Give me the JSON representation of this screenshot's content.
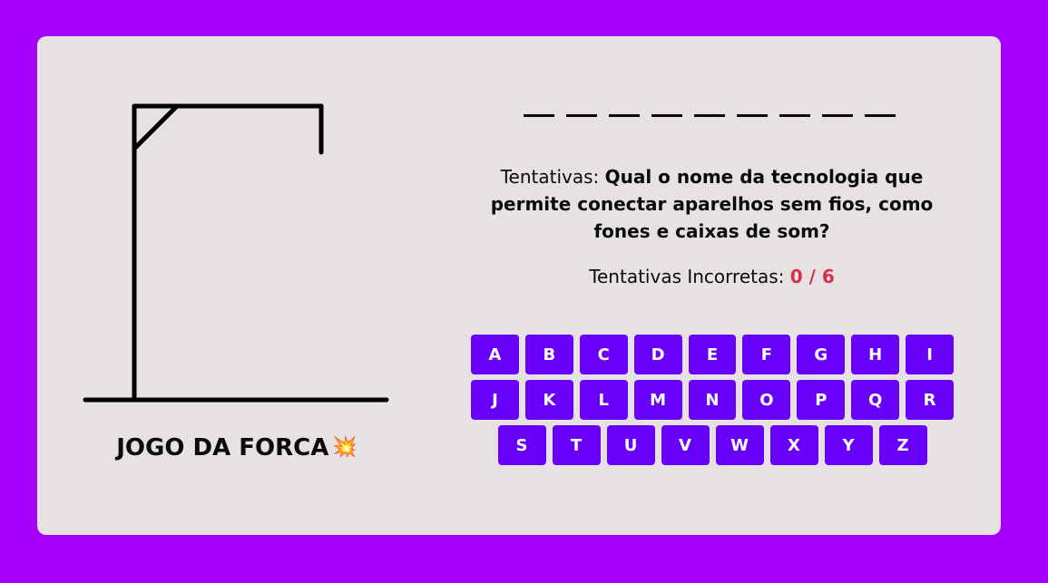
{
  "game": {
    "title": "JOGO DA FORCA",
    "title_emoji": "💥",
    "word_length": 9,
    "hint_label": "Tentativas:",
    "hint_text": "Qual o nome da tecnologia que permite conectar aparelhos sem fios, como fones e caixas de som?",
    "incorrect_label": "Tentativas Incorretas:",
    "incorrect_count": "0 / 6"
  },
  "keyboard": {
    "rows": [
      [
        "A",
        "B",
        "C",
        "D",
        "E",
        "F",
        "G",
        "H",
        "I"
      ],
      [
        "J",
        "K",
        "L",
        "M",
        "N",
        "O",
        "P",
        "Q",
        "R"
      ],
      [
        "S",
        "T",
        "U",
        "V",
        "W",
        "X",
        "Y",
        "Z"
      ]
    ]
  },
  "colors": {
    "page_background": "#a500fb",
    "card_background": "#e6e1e2",
    "key_background": "#6900fc",
    "incorrect_count": "#d6304b"
  }
}
